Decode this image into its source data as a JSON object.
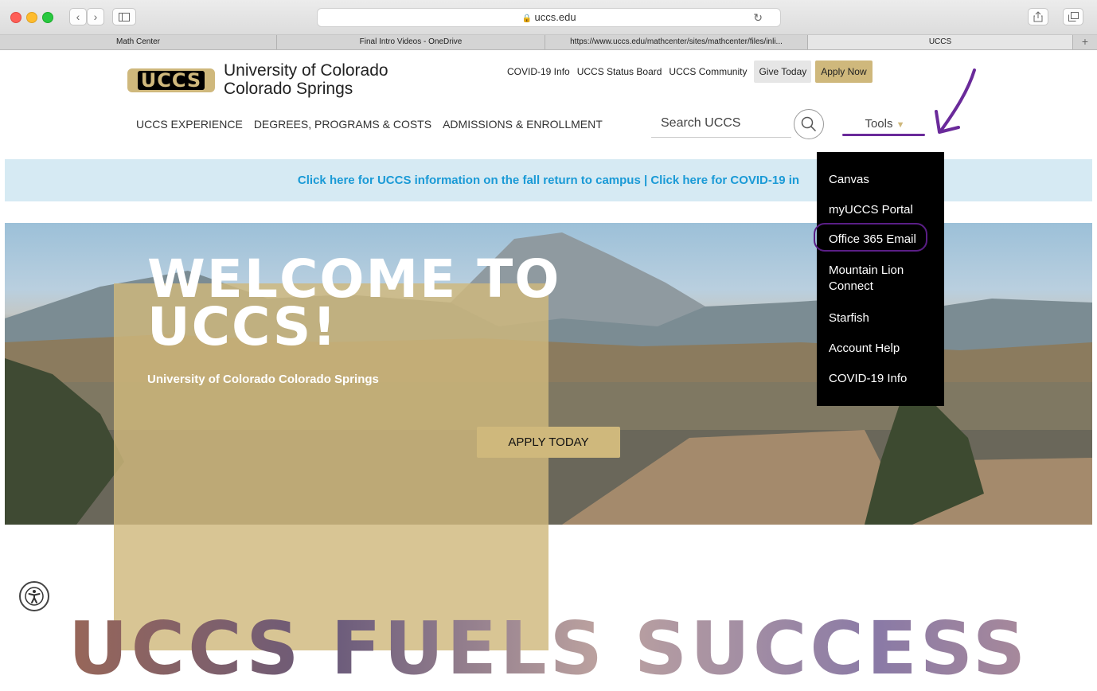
{
  "browser": {
    "url": "uccs.edu",
    "tabs": [
      {
        "label": "Math Center",
        "active": false
      },
      {
        "label": "Final Intro Videos - OneDrive",
        "active": false
      },
      {
        "label": "https://www.uccs.edu/mathcenter/sites/mathcenter/files/inli...",
        "active": false
      },
      {
        "label": "UCCS",
        "active": true
      }
    ],
    "new_tab_label": "+"
  },
  "header": {
    "logo_text": "UCCS",
    "university_line1": "University of Colorado",
    "university_line2": "Colorado Springs",
    "top_links": [
      "COVID-19 Info",
      "UCCS Status Board",
      "UCCS Community"
    ],
    "give_today": "Give Today",
    "apply_now": "Apply Now"
  },
  "nav": {
    "items": [
      "UCCS EXPERIENCE",
      "DEGREES, PROGRAMS & COSTS",
      "ADMISSIONS & ENROLLMENT"
    ],
    "search_placeholder": "Search UCCS",
    "tools_label": "Tools"
  },
  "banner": {
    "text": "Click here for UCCS information on the fall return to campus | Click here for COVID-19 in"
  },
  "hero": {
    "welcome_line1": "WELCOME TO",
    "welcome_line2": "UCCS!",
    "subtitle": "University of Colorado Colorado Springs",
    "apply_button": "APPLY TODAY"
  },
  "tools_menu": {
    "items": [
      "Canvas",
      "myUCCS Portal",
      "Office 365 Email",
      "Mountain Lion Connect",
      "Starfish",
      "Account Help",
      "COVID-19 Info"
    ],
    "highlighted": "Office 365 Email"
  },
  "footer": {
    "big_heading": "UCCS FUELS SUCCESS"
  },
  "colors": {
    "gold": "#cfb87c",
    "annotation_purple": "#6a2a9a",
    "banner_link_blue": "#1a9ad6"
  }
}
